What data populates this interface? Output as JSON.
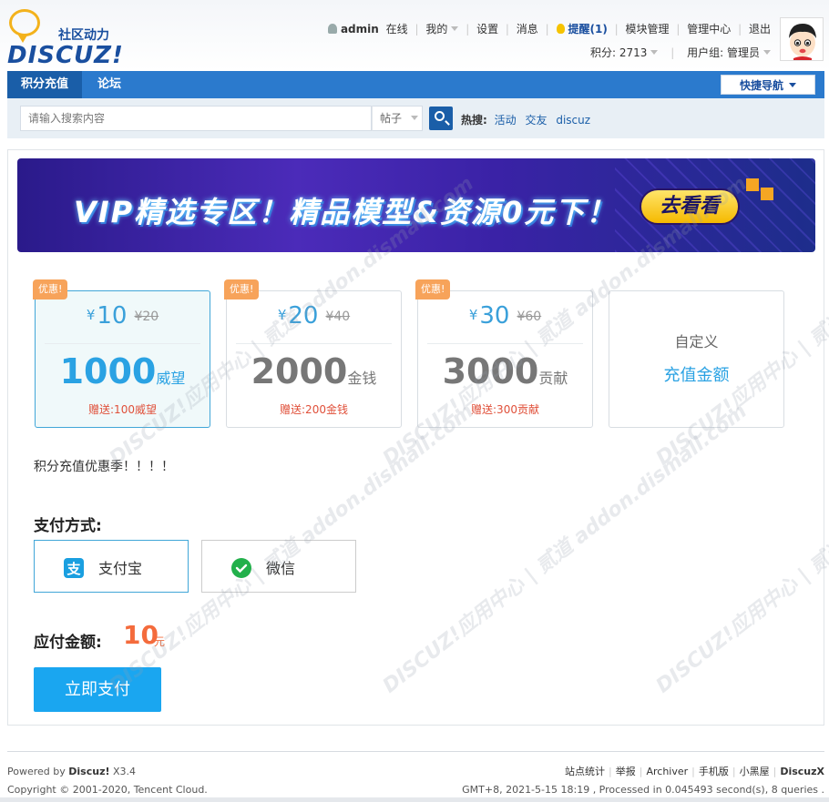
{
  "header": {
    "logo_slogan": "社区动力",
    "logo_brand": "DISCUZ!",
    "user_menu": {
      "username": "admin",
      "status": "在线",
      "my": "我的",
      "settings": "设置",
      "messages": "消息",
      "remind": "提醒(1)",
      "module_admin": "模块管理",
      "admin_center": "管理中心",
      "logout": "退出"
    },
    "credits": "积分: 2713",
    "usergroup": "用户组: 管理员"
  },
  "nav": {
    "tabs": [
      {
        "label": "积分充值",
        "active": true
      },
      {
        "label": "论坛",
        "active": false
      }
    ],
    "quick_nav": "快捷导航"
  },
  "search": {
    "placeholder": "请输入搜索内容",
    "type": "帖子",
    "hot_label": "热搜:",
    "hot_items": [
      "活动",
      "交友",
      "discuz"
    ]
  },
  "banner": {
    "text": "VIP精选专区！精品模型&资源0元下！",
    "button": "去看看"
  },
  "packages": [
    {
      "badge": "优惠!",
      "yen": "¥",
      "price": "10",
      "orig_price": "¥20",
      "amount": "1000",
      "unit": "威望",
      "gift": "赠送:100威望",
      "selected": true
    },
    {
      "badge": "优惠!",
      "yen": "¥",
      "price": "20",
      "orig_price": "¥40",
      "amount": "2000",
      "unit": "金钱",
      "gift": "赠送:200金钱",
      "selected": false
    },
    {
      "badge": "优惠!",
      "yen": "¥",
      "price": "30",
      "orig_price": "¥60",
      "amount": "3000",
      "unit": "贡献",
      "gift": "赠送:300贡献",
      "selected": false
    }
  ],
  "custom": {
    "line1": "自定义",
    "line2": "充值金额"
  },
  "promo_text": "积分充值优惠季！！！！",
  "payment": {
    "label": "支付方式:",
    "methods": [
      {
        "name": "支付宝",
        "icon": "alipay-icon",
        "color": "#1a9fe0",
        "selected": true
      },
      {
        "name": "微信",
        "icon": "wechat-icon",
        "color": "#22b04b",
        "selected": false
      }
    ]
  },
  "total": {
    "label": "应付金额:",
    "value": "10",
    "unit": "元"
  },
  "pay_button": "立即支付",
  "watermark": "DISCUZ!应用中心 | 贰道 addon.dismall.com",
  "footer": {
    "powered_prefix": "Powered by",
    "powered_brand": "Discuz!",
    "version": "X3.4",
    "copyright": "Copyright © 2001-2020, Tencent Cloud.",
    "links": [
      "站点统计",
      "举报",
      "Archiver",
      "手机版",
      "小黑屋"
    ],
    "brand_right": "DiscuzX",
    "stats": "GMT+8, 2021-5-15 18:19 , Processed in 0.045493 second(s), 8 queries ."
  },
  "colors": {
    "nav_blue": "#2b7acd",
    "accent_blue": "#2aa2e3",
    "badge_orange": "#f7a35a",
    "gift_red": "#e0503a",
    "total_orange": "#f46b3c",
    "pay_button": "#1aa6f0"
  }
}
